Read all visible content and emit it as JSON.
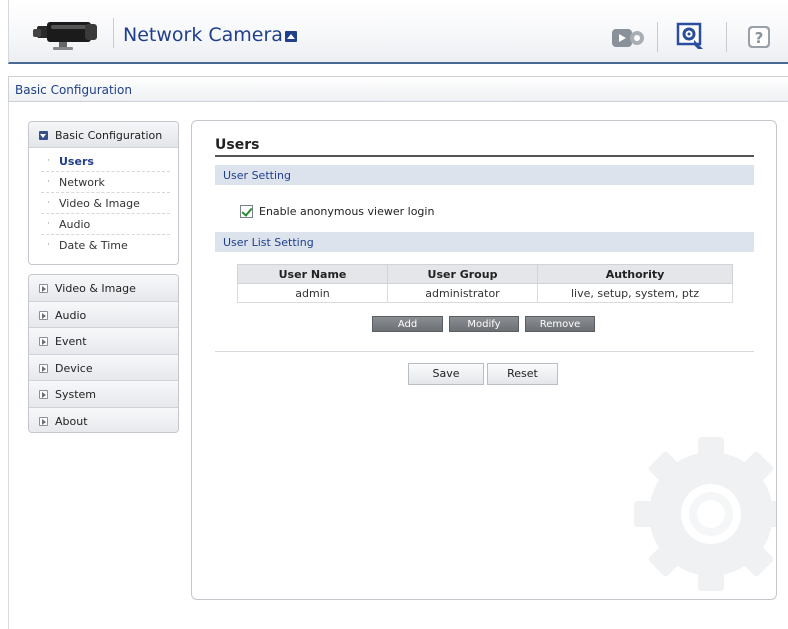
{
  "header": {
    "title": "Network Camera",
    "icons": [
      "camera-logo",
      "live-view-icon",
      "setup-icon",
      "help-icon"
    ]
  },
  "breadcrumb": "Basic Configuration",
  "sidebar": {
    "section": {
      "label": "Basic Configuration",
      "items": [
        {
          "label": "Users",
          "active": true
        },
        {
          "label": "Network"
        },
        {
          "label": "Video & Image"
        },
        {
          "label": "Audio"
        },
        {
          "label": "Date & Time"
        }
      ]
    },
    "categories": [
      {
        "label": "Video & Image"
      },
      {
        "label": "Audio"
      },
      {
        "label": "Event"
      },
      {
        "label": "Device"
      },
      {
        "label": "System"
      },
      {
        "label": "About"
      }
    ]
  },
  "main": {
    "title": "Users",
    "user_setting": {
      "label": "User Setting",
      "anonymous_login": {
        "label": "Enable anonymous viewer login",
        "checked": true
      }
    },
    "user_list": {
      "label": "User List Setting",
      "columns": [
        "User Name",
        "User Group",
        "Authority"
      ],
      "rows": [
        [
          "admin",
          "administrator",
          "live, setup, system, ptz"
        ]
      ],
      "buttons": {
        "add": "Add",
        "modify": "Modify",
        "remove": "Remove"
      }
    },
    "actions": {
      "save": "Save",
      "reset": "Reset"
    }
  },
  "colors": {
    "accent": "#1f3f8a",
    "section_bar": "#dde3ed",
    "header_border": "#4a6a94"
  }
}
